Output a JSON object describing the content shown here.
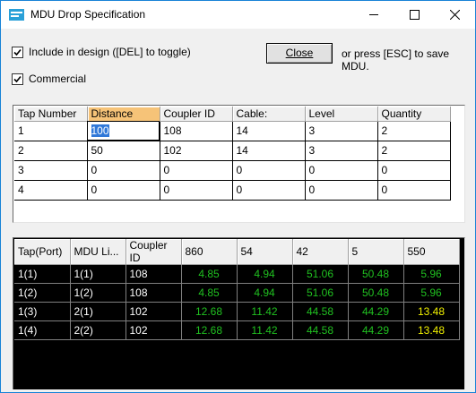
{
  "window": {
    "title": "MDU Drop Specification",
    "accent": "#1883d7"
  },
  "options": {
    "include_label": "Include in design ([DEL] to toggle)",
    "include_checked": true,
    "commercial_label": "Commercial",
    "commercial_checked": true
  },
  "close_button": {
    "label": "Close"
  },
  "hint": "or press [ESC] to save MDU.",
  "tap_grid": {
    "columns": [
      "Tap Number",
      "Distance",
      "Coupler ID",
      "Cable:",
      "Level",
      "Quantity"
    ],
    "active_column": "Distance",
    "editing_cell_value": "100",
    "rows": [
      [
        "1",
        "100",
        "108",
        "14",
        "3",
        "2"
      ],
      [
        "2",
        "50",
        "102",
        "14",
        "3",
        "2"
      ],
      [
        "3",
        "0",
        "0",
        "0",
        "0",
        "0"
      ],
      [
        "4",
        "0",
        "0",
        "0",
        "0",
        "0"
      ]
    ]
  },
  "level_grid": {
    "columns": [
      "Tap(Port)",
      "MDU Li...",
      "Coupler ID",
      "860",
      "54",
      "42",
      "5",
      "550"
    ],
    "rows": [
      [
        "1(1)",
        "1(1)",
        "108",
        "4.85",
        "4.94",
        "51.06",
        "50.48",
        "5.96"
      ],
      [
        "1(2)",
        "1(2)",
        "108",
        "4.85",
        "4.94",
        "51.06",
        "50.48",
        "5.96"
      ],
      [
        "1(3)",
        "2(1)",
        "102",
        "12.68",
        "11.42",
        "44.58",
        "44.29",
        "13.48"
      ],
      [
        "1(4)",
        "2(2)",
        "102",
        "12.68",
        "11.42",
        "44.58",
        "44.29",
        "13.48"
      ]
    ],
    "ok_color": "#20c020",
    "warn_color": "#f0f000"
  }
}
